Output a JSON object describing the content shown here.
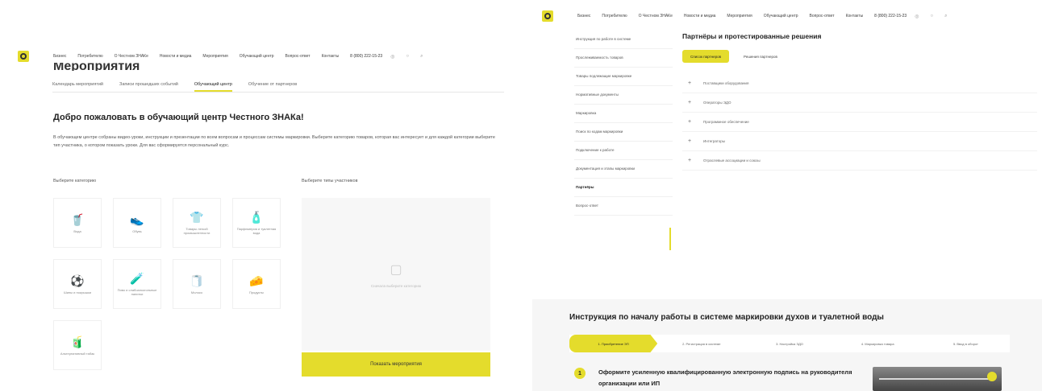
{
  "header": {
    "nav": [
      "Бизнес",
      "Потребителю",
      "О Честном ЗНАКе",
      "Новости и медиа",
      "Мероприятия",
      "Обучающий центр",
      "Вопрос-ответ",
      "Контакты"
    ],
    "phone": "8 (800) 222-15-23"
  },
  "left": {
    "page_title": "Мероприятия",
    "tabs": [
      "Календарь мероприятий",
      "Записи прошедших событий",
      "Обучающий центр",
      "Обучение от партнеров"
    ],
    "welcome_title": "Добро пожаловать в обучающий центр Честного ЗНАКа!",
    "intro": "В обучающем центре собраны видео-уроки, инструкции и презентации по всем вопросам и процессам системы маркировки. Выберите категорию товаров, которая вас интересует и для каждой категории выберите тип участника, о котором показать уроки. Для вас сформируется персональный курс.",
    "categories_label": "Выберите категорию",
    "types_label": "Выберите типы участников",
    "categories": [
      {
        "icon": "🥤",
        "name": "Вода"
      },
      {
        "icon": "👟",
        "name": "Обувь"
      },
      {
        "icon": "👕",
        "name": "Товары легкой промышленности"
      },
      {
        "icon": "🧴",
        "name": "Парфюмерия и туалетная вода"
      },
      {
        "icon": "⚽",
        "name": "Шины и покрышки"
      },
      {
        "icon": "🧪",
        "name": "Пиво и слабоалкогольные напитки"
      },
      {
        "icon": "🧻",
        "name": "Молоко"
      },
      {
        "icon": "🧀",
        "name": "Продукты"
      },
      {
        "icon": "🧃",
        "name": "Альтернативный табак"
      }
    ],
    "types_placeholder": "Сначала выберите категорию",
    "show_button": "Показать мероприятия"
  },
  "right": {
    "sidebar": [
      "Инструкция по работе в системе",
      "Прослеживаемость товаров",
      "Товары подлежащие маркировке",
      "Нормативные документы",
      "Маркировка",
      "Поиск по кодам маркировки",
      "Подключение к работе",
      "Документация и этапы маркировки",
      "Партнёры",
      "Вопрос-ответ"
    ],
    "sidebar_active": "Партнёры",
    "partners_title": "Партнёры и протестированные решения",
    "partner_tabs": [
      "Список партнеров",
      "Решения партнеров"
    ],
    "accordion": [
      "Поставщики оборудования",
      "Операторы ЭДО",
      "Программное обеспечение",
      "Интеграторы",
      "Отраслевые ассоциации и союзы"
    ],
    "instruction_title": "Инструкция по началу работы в системе маркировки духов и туалетной воды",
    "steps": [
      "1. Приобретение ЭП",
      "2. Регистрация в системе",
      "3. Настройка ЭДО",
      "4. Маркировка товара",
      "5. Ввод в оборот"
    ],
    "step_number": "1",
    "step_text": "Оформите усиленную квалифицированную электронную подпись на руководителя организации или ИП"
  },
  "colors": {
    "accent": "#e4dc2c",
    "text": "#222222",
    "muted": "#888888"
  }
}
